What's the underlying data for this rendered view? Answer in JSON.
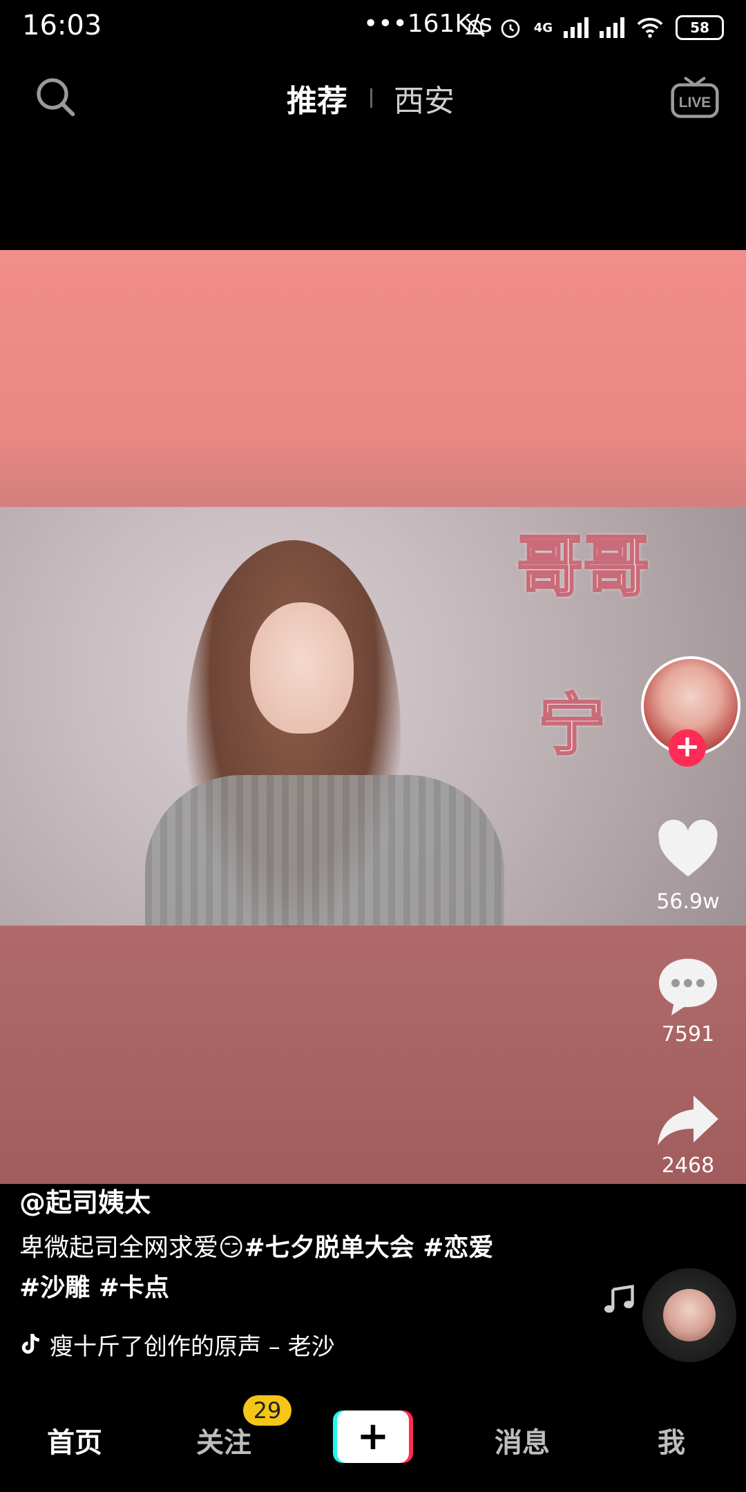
{
  "status_bar": {
    "time": "16:03",
    "network_speed": "•••161K/s",
    "network_type": "4G",
    "battery": "58"
  },
  "top_nav": {
    "tab_recommend": "推荐",
    "tab_city": "西安"
  },
  "video": {
    "overlay_text_1": "哥哥",
    "overlay_text_2": "宁"
  },
  "actions": {
    "likes": "56.9w",
    "comments": "7591",
    "shares": "2468"
  },
  "caption": {
    "author": "@起司姨太",
    "desc_text": "卑微起司全网求爱",
    "emoji": "😏",
    "tags_line1": "#七夕脱单大会 #恋爱",
    "tags_line2": "#沙雕 #卡点",
    "music": "瘦十斤了创作的原声 – 老沙"
  },
  "bottom_nav": {
    "home": "首页",
    "follow": "关注",
    "follow_badge": "29",
    "add": "+",
    "messages": "消息",
    "me": "我"
  },
  "colors": {
    "accent_red": "#fe2c55",
    "accent_cyan": "#25f4ee",
    "badge_yellow": "#f5c518"
  },
  "icons": [
    "search-icon",
    "live-icon",
    "heart-icon",
    "comment-icon",
    "share-icon",
    "music-note-icon",
    "tiktok-logo-icon",
    "plus-icon"
  ]
}
